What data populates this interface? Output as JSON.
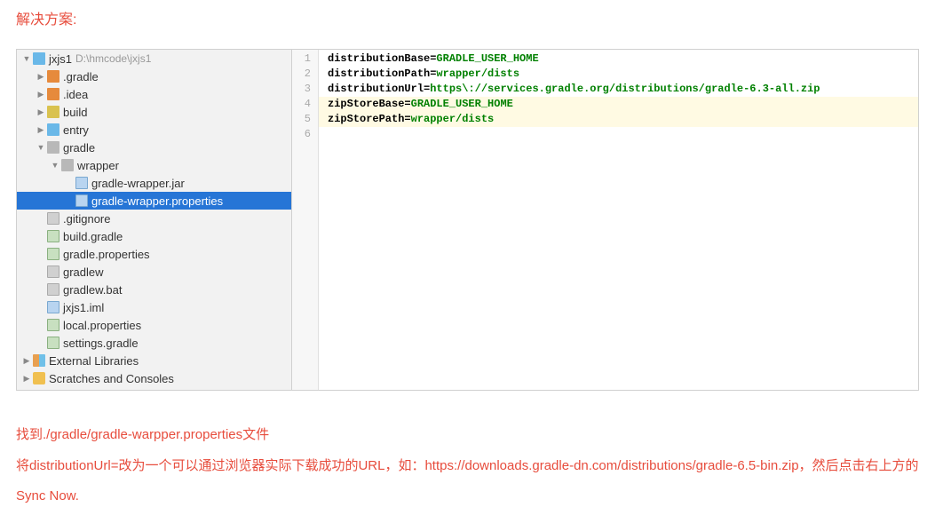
{
  "title": "解决方案:",
  "tree": {
    "root": {
      "name": "jxjs1",
      "path": "D:\\hmcode\\jxjs1"
    },
    "items": [
      {
        "indent": 0,
        "arrow": "open",
        "icon": "folder-blue",
        "label": "jxjs1",
        "pathHint": "D:\\hmcode\\jxjs1"
      },
      {
        "indent": 1,
        "arrow": "closed",
        "icon": "folder-orange",
        "label": ".gradle"
      },
      {
        "indent": 1,
        "arrow": "closed",
        "icon": "folder-orange",
        "label": ".idea"
      },
      {
        "indent": 1,
        "arrow": "closed",
        "icon": "folder-yellow",
        "label": "build"
      },
      {
        "indent": 1,
        "arrow": "closed",
        "icon": "folder-blue",
        "label": "entry"
      },
      {
        "indent": 1,
        "arrow": "open",
        "icon": "folder-gray",
        "label": "gradle"
      },
      {
        "indent": 2,
        "arrow": "open",
        "icon": "folder-gray",
        "label": "wrapper"
      },
      {
        "indent": 3,
        "arrow": "none",
        "icon": "file-blue",
        "label": "gradle-wrapper.jar"
      },
      {
        "indent": 3,
        "arrow": "none",
        "icon": "file-blue",
        "label": "gradle-wrapper.properties",
        "selected": true
      },
      {
        "indent": 1,
        "arrow": "none",
        "icon": "file-icon",
        "label": ".gitignore"
      },
      {
        "indent": 1,
        "arrow": "none",
        "icon": "file-green",
        "label": "build.gradle"
      },
      {
        "indent": 1,
        "arrow": "none",
        "icon": "file-green",
        "label": "gradle.properties"
      },
      {
        "indent": 1,
        "arrow": "none",
        "icon": "file-icon",
        "label": "gradlew"
      },
      {
        "indent": 1,
        "arrow": "none",
        "icon": "file-icon",
        "label": "gradlew.bat"
      },
      {
        "indent": 1,
        "arrow": "none",
        "icon": "file-blue",
        "label": "jxjs1.iml"
      },
      {
        "indent": 1,
        "arrow": "none",
        "icon": "file-green",
        "label": "local.properties"
      },
      {
        "indent": 1,
        "arrow": "none",
        "icon": "file-green",
        "label": "settings.gradle"
      },
      {
        "indent": 0,
        "arrow": "closed",
        "icon": "lib-icon",
        "label": "External Libraries"
      },
      {
        "indent": 0,
        "arrow": "closed",
        "icon": "scratch-icon",
        "label": "Scratches and Consoles"
      }
    ]
  },
  "code": {
    "lines": [
      {
        "n": 1,
        "key": "distributionBase",
        "val": "GRADLE_USER_HOME",
        "highlight": false
      },
      {
        "n": 2,
        "key": "distributionPath",
        "val": "wrapper/dists",
        "highlight": false
      },
      {
        "n": 3,
        "key": "distributionUrl",
        "val": "https\\://services.gradle.org/distributions/gradle-6.3-all.zip",
        "highlight": false
      },
      {
        "n": 4,
        "key": "zipStoreBase",
        "val": "GRADLE_USER_HOME",
        "highlight": true
      },
      {
        "n": 5,
        "key": "zipStorePath",
        "val": "wrapper/dists",
        "highlight": true
      },
      {
        "n": 6,
        "key": "",
        "val": "",
        "highlight": false
      }
    ]
  },
  "desc": {
    "line1": "找到./gradle/gradle-warpper.properties文件",
    "line2": "将distributionUrl=改为一个可以通过浏览器实际下载成功的URL，如：https://downloads.gradle-dn.com/distributions/gradle-6.5-bin.zip，然后点击右上方的Sync Now."
  }
}
